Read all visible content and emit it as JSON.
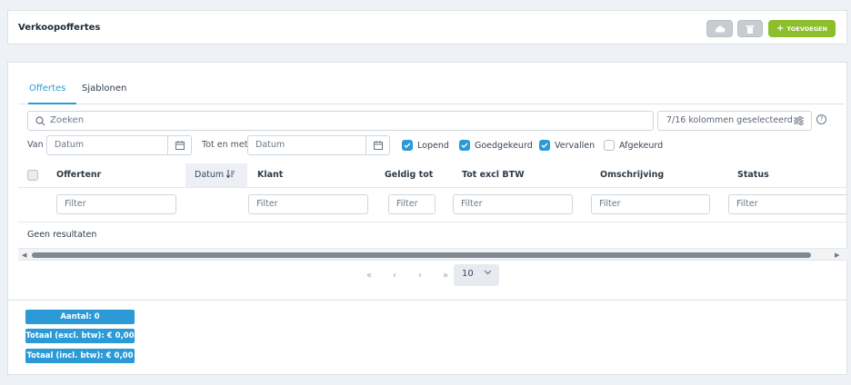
{
  "header": {
    "title": "Verkoopoffertes",
    "add_label": "TOEVOEGEN"
  },
  "tabs": [
    {
      "label": "Offertes",
      "active": true
    },
    {
      "label": "Sjablonen",
      "active": false
    }
  ],
  "search": {
    "placeholder": "Zoeken"
  },
  "columns_selector": {
    "label": "7/16 kolommen geselecteerd"
  },
  "date_filter": {
    "from_label": "Van",
    "to_label": "Tot en met",
    "placeholder": "Datum"
  },
  "status_filters": [
    {
      "label": "Lopend",
      "checked": true
    },
    {
      "label": "Goedgekeurd",
      "checked": true
    },
    {
      "label": "Vervallen",
      "checked": true
    },
    {
      "label": "Afgekeurd",
      "checked": false
    }
  ],
  "table": {
    "columns": [
      "Offertenr",
      "Datum",
      "Klant",
      "Geldig tot",
      "Tot excl BTW",
      "Omschrijving",
      "Status"
    ],
    "filter_placeholder": "Filter",
    "empty_text": "Geen resultaten"
  },
  "pagination": {
    "first": "«",
    "prev": "‹",
    "next": "›",
    "last": "»",
    "page_size": "10"
  },
  "summary": {
    "count": "Aantal: 0",
    "total_excl": "Totaal (excl. btw): € 0,00",
    "total_incl": "Totaal (incl. btw): € 0,00"
  },
  "colors": {
    "accent": "#2b9ad6",
    "add_button": "#8cbf2b"
  }
}
